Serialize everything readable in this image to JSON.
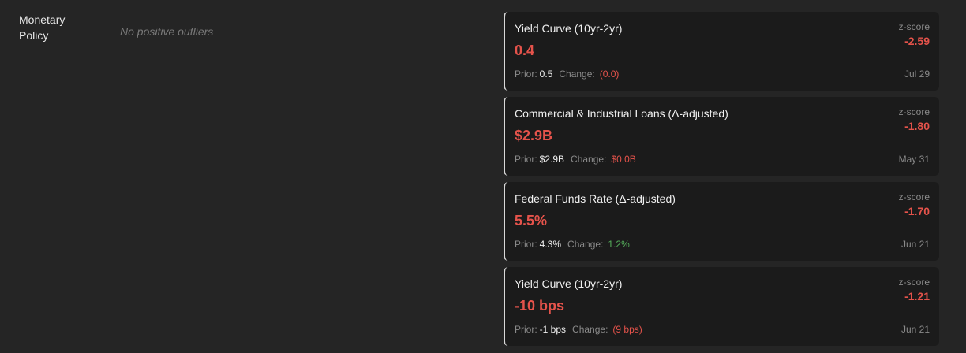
{
  "category": {
    "line1": "Monetary",
    "line2": "Policy"
  },
  "empty_message": "No positive outliers",
  "cards": [
    {
      "title": "Yield Curve (10yr-2yr)",
      "value": "0.4",
      "prior_label": "Prior:",
      "prior": "0.5",
      "change_label": "Change:",
      "change": "(0.0)",
      "change_color": "#e5534b",
      "z_label": "z-score",
      "z": "-2.59",
      "date": "Jul 29"
    },
    {
      "title": "Commercial & Industrial Loans (Δ-adjusted)",
      "value": "$2.9B",
      "prior_label": "Prior:",
      "prior": "$2.9B",
      "change_label": "Change:",
      "change": "$0.0B",
      "change_color": "#e5534b",
      "z_label": "z-score",
      "z": "-1.80",
      "date": "May 31"
    },
    {
      "title": "Federal Funds Rate (Δ-adjusted)",
      "value": "5.5%",
      "prior_label": "Prior:",
      "prior": "4.3%",
      "change_label": "Change:",
      "change": "1.2%",
      "change_color": "#56b05c",
      "z_label": "z-score",
      "z": "-1.70",
      "date": "Jun 21"
    },
    {
      "title": "Yield Curve (10yr-2yr)",
      "value": "-10 bps",
      "prior_label": "Prior:",
      "prior": "-1 bps",
      "change_label": "Change:",
      "change": "(9 bps)",
      "change_color": "#e5534b",
      "z_label": "z-score",
      "z": "-1.21",
      "date": "Jun 21"
    }
  ]
}
